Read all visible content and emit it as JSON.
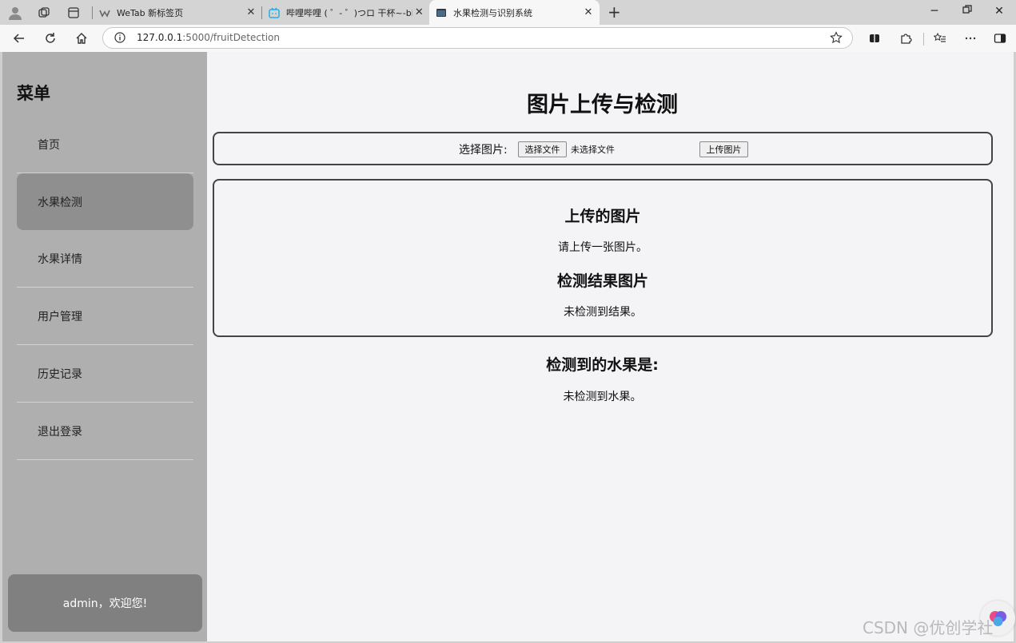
{
  "browser": {
    "tabs": [
      {
        "title": "WeTab 新标签页",
        "active": false
      },
      {
        "title": "哔哩哔哩 ( ゜- ゜)つロ 干杯~-bilibili",
        "active": false
      },
      {
        "title": "水果检测与识别系统",
        "active": true
      }
    ],
    "url_host": "127.0.0.1",
    "url_rest": ":5000/fruitDetection"
  },
  "sidebar": {
    "title": "菜单",
    "items": [
      {
        "label": "首页",
        "active": false
      },
      {
        "label": "水果检测",
        "active": true
      },
      {
        "label": "水果详情",
        "active": false
      },
      {
        "label": "用户管理",
        "active": false
      },
      {
        "label": "历史记录",
        "active": false
      },
      {
        "label": "退出登录",
        "active": false
      }
    ],
    "welcome": "admin，欢迎您!"
  },
  "main": {
    "title": "图片上传与检测",
    "upload": {
      "label": "选择图片:",
      "choose_button": "选择文件",
      "no_file": "未选择文件",
      "upload_button": "上传图片"
    },
    "uploaded_heading": "上传的图片",
    "uploaded_msg": "请上传一张图片。",
    "result_heading": "检测结果图片",
    "result_msg": "未检测到结果。",
    "fruit_heading": "检测到的水果是:",
    "fruit_msg": "未检测到水果。"
  },
  "watermark": "CSDN @优创学社",
  "colors": {
    "sidebar_bg": "#afafaf",
    "sidebar_active": "#8f8f8f",
    "user_box": "#808080",
    "content_bg": "#f4f4f7"
  }
}
